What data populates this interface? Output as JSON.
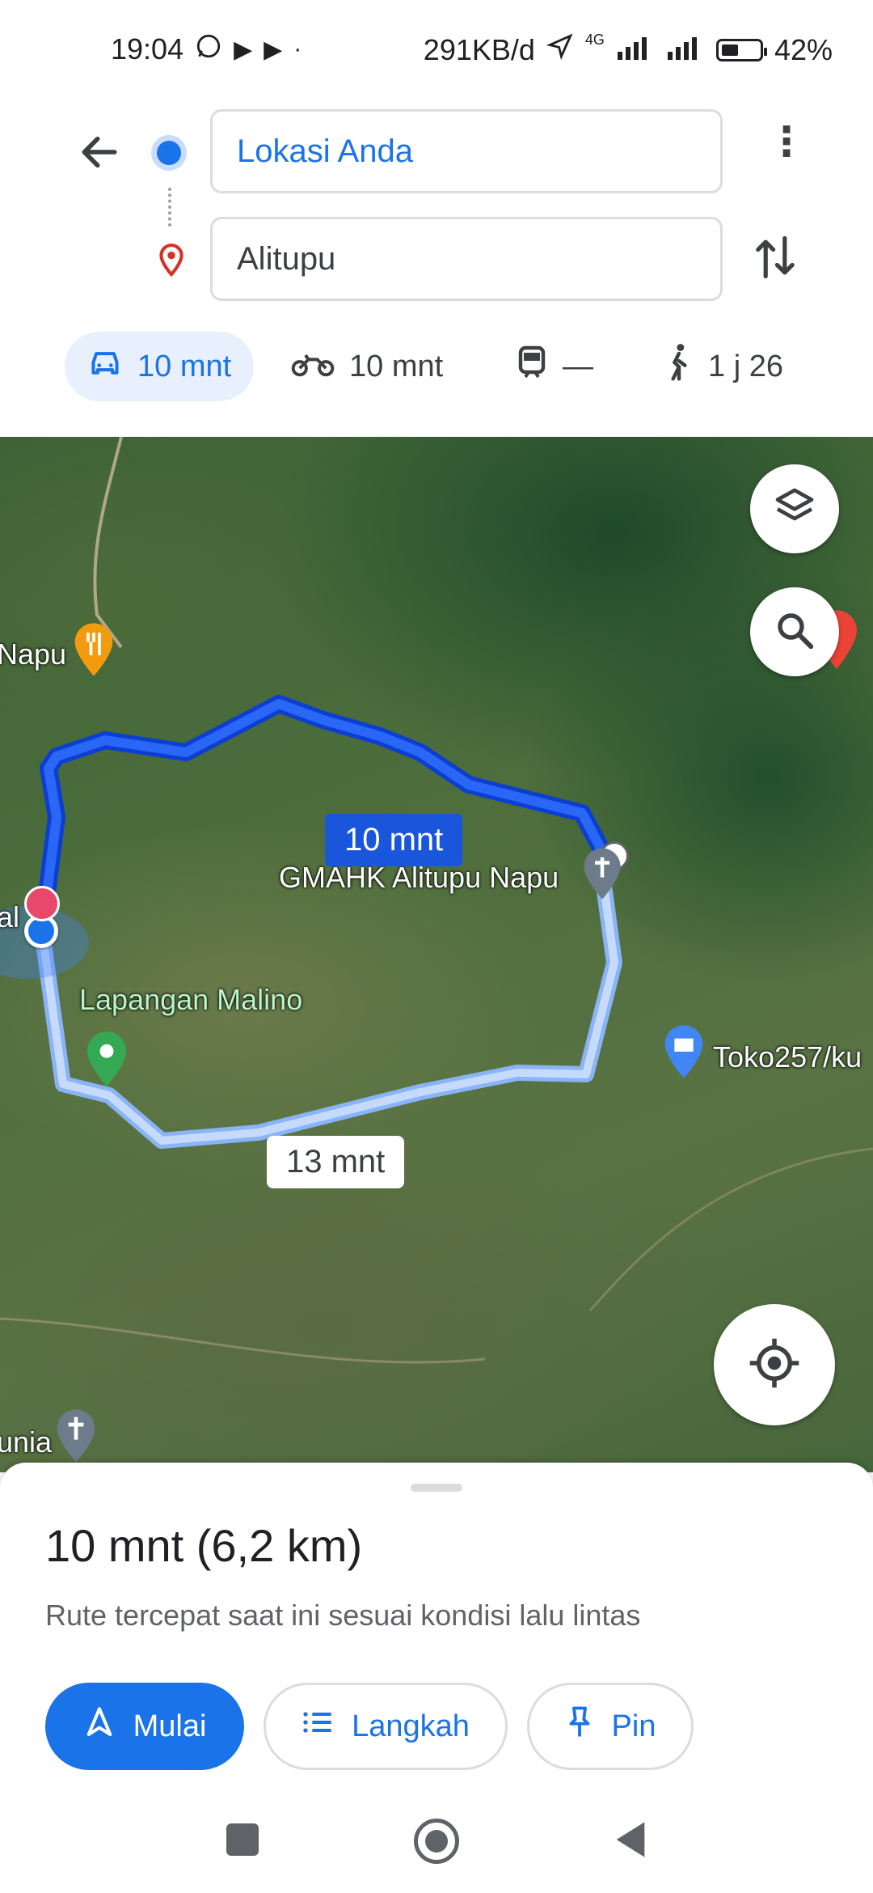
{
  "status_bar": {
    "time": "19:04",
    "data_rate": "291KB/d",
    "network": "4G",
    "battery": "42%"
  },
  "directions": {
    "origin": "Lokasi Anda",
    "destination": "Alitupu"
  },
  "modes": [
    {
      "name": "car",
      "label": "10 mnt"
    },
    {
      "name": "motorcycle",
      "label": "10 mnt"
    },
    {
      "name": "transit",
      "label": "—"
    },
    {
      "name": "walk",
      "label": "1 j 26"
    }
  ],
  "map": {
    "labels": {
      "napu": "Napu",
      "gmahk": "GMAHK Alitupu Napu",
      "lapangan": "Lapangan Malino",
      "toko": "Toko257/ku",
      "al": "al",
      "unia": "unia"
    },
    "route_primary_time": "10 mnt",
    "route_alt_time": "13 mnt"
  },
  "sheet": {
    "summary": "10 mnt (6,2 km)",
    "subtitle": "Rute tercepat saat ini sesuai kondisi lalu lintas",
    "start_label": "Mulai",
    "steps_label": "Langkah",
    "pin_label": "Pin"
  }
}
